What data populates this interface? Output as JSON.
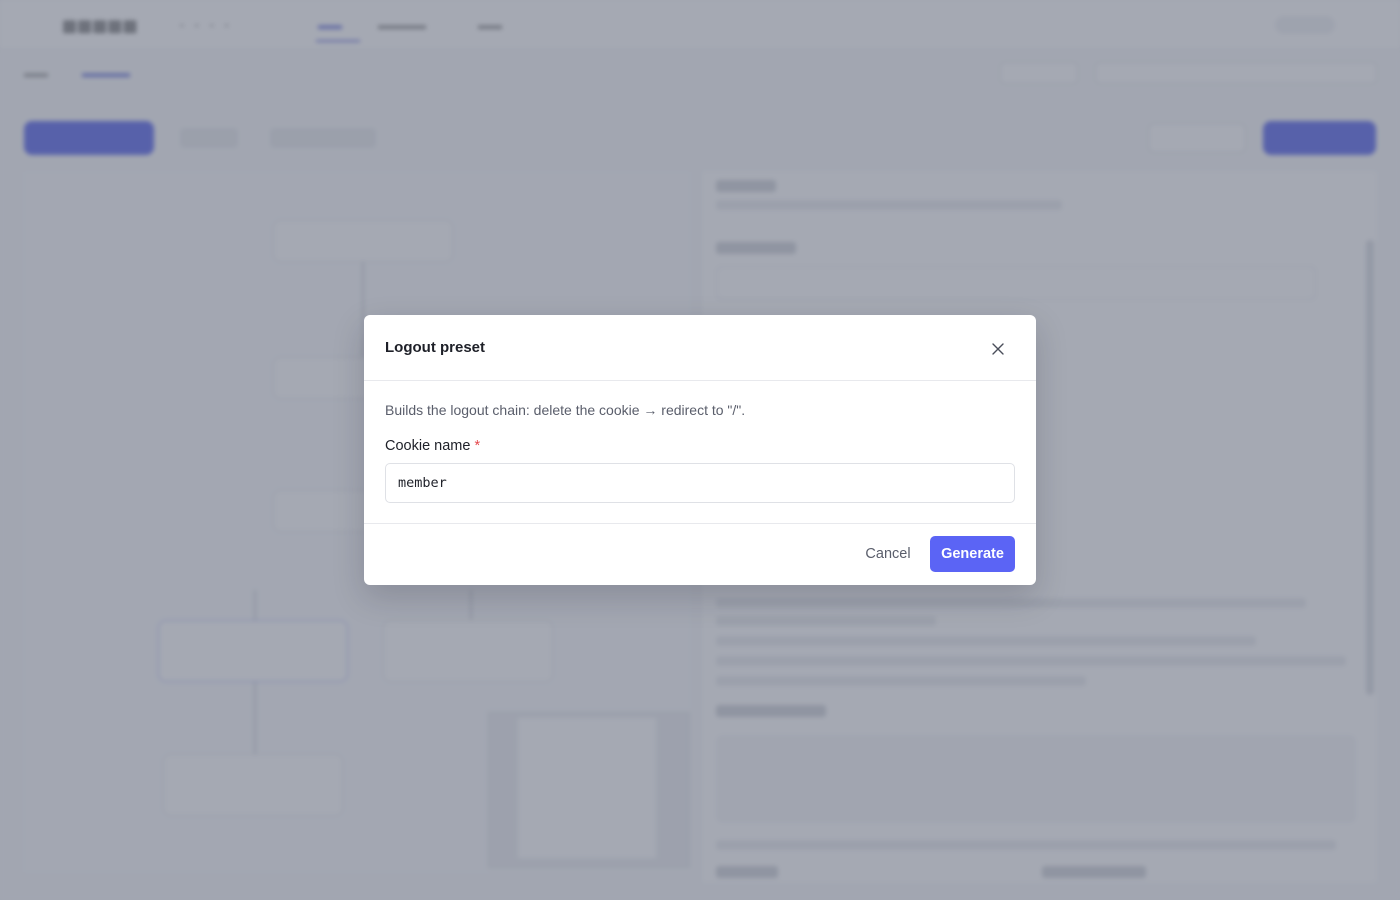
{
  "modal": {
    "title": "Logout preset",
    "description": "Builds the logout chain: delete the cookie → redirect to \"/\".",
    "field": {
      "label": "Cookie name",
      "required_mark": "*",
      "value": "member"
    },
    "buttons": {
      "cancel": "Cancel",
      "generate": "Generate"
    }
  },
  "icons": {
    "close": "close-icon"
  },
  "colors": {
    "primary": "#5b64f5",
    "required": "#e5484d",
    "overlay": "rgba(110, 116, 132, 0.62)"
  }
}
